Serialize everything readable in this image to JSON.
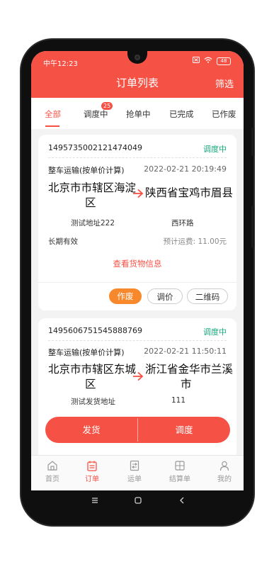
{
  "status_bar": {
    "time": "中午12:23",
    "battery": "48"
  },
  "header": {
    "title": "订单列表",
    "filter_label": "筛选"
  },
  "tabs": [
    {
      "label": "全部",
      "active": true
    },
    {
      "label": "调度中",
      "badge": "25"
    },
    {
      "label": "抢单中"
    },
    {
      "label": "已完成"
    },
    {
      "label": "已作废"
    }
  ],
  "orders": [
    {
      "order_no": "1495735002121474049",
      "status": "调度中",
      "transport_type": "整车运输(按单价计算)",
      "datetime": "2022-02-21 20:19:49",
      "from_city_line1": "北京市市辖区海淀",
      "from_city_line2": "区",
      "to_city_line1": "陕西省宝鸡市眉县",
      "from_address": "测试地址222",
      "to_address": "西环路",
      "validity": "长期有效",
      "estimated_fee": "预计运费: 11.00元",
      "view_cargo": "查看货物信息",
      "buttons": {
        "void": "作废",
        "adjust_price": "调价",
        "qrcode": "二维码"
      }
    },
    {
      "order_no": "1495606751545888769",
      "status": "调度中",
      "transport_type": "整车运输(按单价计算)",
      "datetime": "2022-02-21 11:50:11",
      "from_city_line1": "北京市市辖区东城",
      "from_city_line2": "区",
      "to_city_line1": "浙江省金华市兰溪",
      "to_city_line2": "市",
      "from_address": "测试发货地址",
      "to_address": "111"
    }
  ],
  "action_bar": {
    "ship": "发货",
    "dispatch": "调度"
  },
  "bottom_nav": [
    {
      "label": "首页",
      "icon": "home-icon"
    },
    {
      "label": "订单",
      "icon": "order-icon",
      "active": true
    },
    {
      "label": "运单",
      "icon": "waybill-icon"
    },
    {
      "label": "结算单",
      "icon": "settlement-icon"
    },
    {
      "label": "我的",
      "icon": "profile-icon"
    }
  ],
  "colors": {
    "primary": "#f65145",
    "status_green": "#17a97b",
    "orange": "#f7892c"
  }
}
